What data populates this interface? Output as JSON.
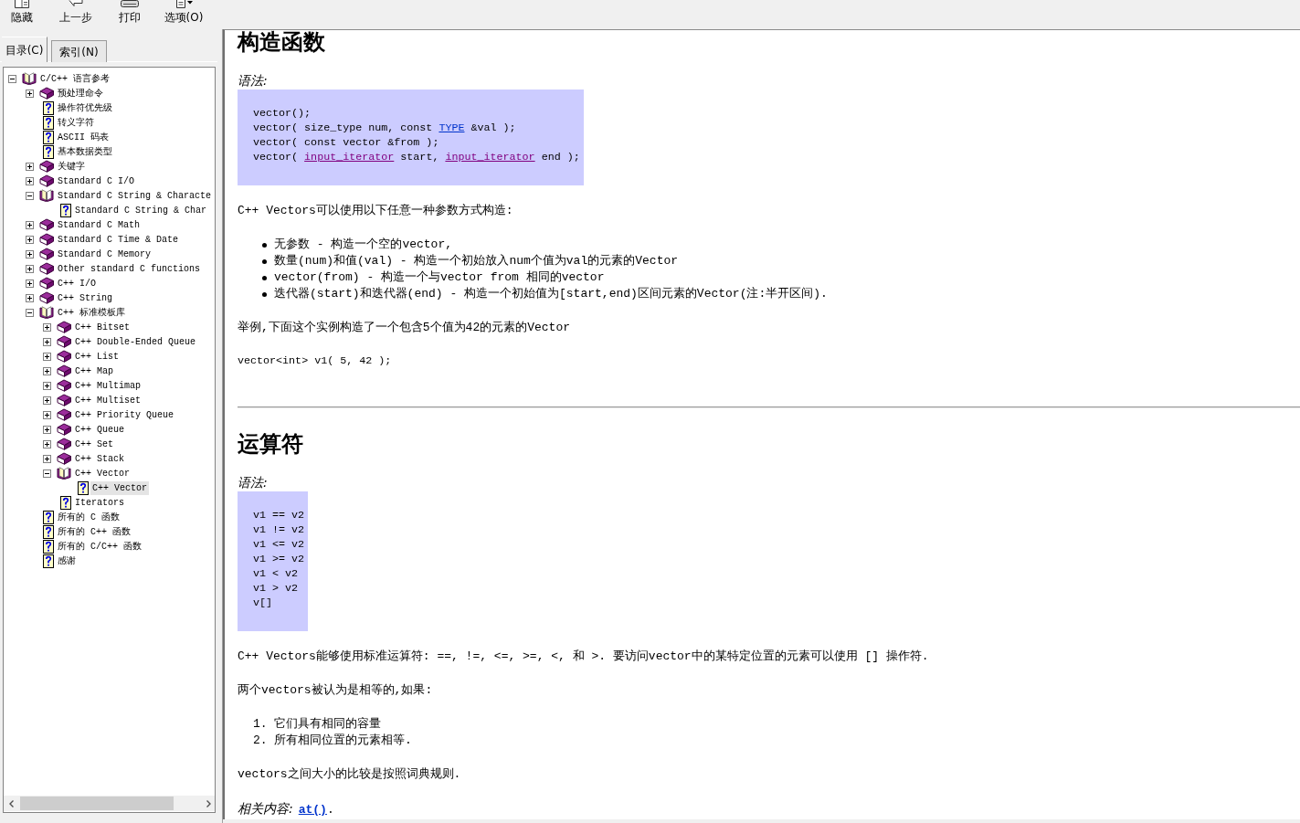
{
  "toolbar": [
    {
      "kind": "hide",
      "label": "隐藏"
    },
    {
      "kind": "back",
      "label": "上一步"
    },
    {
      "kind": "print",
      "label": "打印"
    },
    {
      "kind": "options",
      "label": "选项(O)"
    }
  ],
  "tabs": [
    {
      "label": "目录(C)",
      "selected": true
    },
    {
      "label": "索引(N)",
      "selected": false
    }
  ],
  "tree": [
    {
      "label": "C/C++ 语言参考",
      "kind": "book",
      "expanded": true,
      "selected": false,
      "children": [
        {
          "label": "预处理命令",
          "kind": "book",
          "expanded": false,
          "selected": false
        },
        {
          "label": "操作符优先级",
          "kind": "page",
          "selected": false
        },
        {
          "label": "转义字符",
          "kind": "page",
          "selected": false
        },
        {
          "label": "ASCII 码表",
          "kind": "page",
          "selected": false
        },
        {
          "label": "基本数据类型",
          "kind": "page",
          "selected": false
        },
        {
          "label": "关键字",
          "kind": "book",
          "expanded": false,
          "selected": false
        },
        {
          "label": "Standard C I/O",
          "kind": "book",
          "expanded": false,
          "selected": false
        },
        {
          "label": "Standard C String & Characte",
          "kind": "book",
          "expanded": true,
          "selected": false,
          "children": [
            {
              "label": "Standard C String & Char",
              "kind": "page",
              "selected": false
            }
          ]
        },
        {
          "label": "Standard C Math",
          "kind": "book",
          "expanded": false,
          "selected": false
        },
        {
          "label": "Standard C Time & Date",
          "kind": "book",
          "expanded": false,
          "selected": false
        },
        {
          "label": "Standard C Memory",
          "kind": "book",
          "expanded": false,
          "selected": false
        },
        {
          "label": "Other standard C functions",
          "kind": "book",
          "expanded": false,
          "selected": false
        },
        {
          "label": "C++ I/O",
          "kind": "book",
          "expanded": false,
          "selected": false
        },
        {
          "label": "C++ String",
          "kind": "book",
          "expanded": false,
          "selected": false
        },
        {
          "label": "C++ 标准模板库",
          "kind": "book",
          "expanded": true,
          "selected": false,
          "children": [
            {
              "label": "C++ Bitset",
              "kind": "book",
              "expanded": false,
              "selected": false
            },
            {
              "label": "C++ Double-Ended Queue",
              "kind": "book",
              "expanded": false,
              "selected": false
            },
            {
              "label": "C++ List",
              "kind": "book",
              "expanded": false,
              "selected": false
            },
            {
              "label": "C++ Map",
              "kind": "book",
              "expanded": false,
              "selected": false
            },
            {
              "label": "C++ Multimap",
              "kind": "book",
              "expanded": false,
              "selected": false
            },
            {
              "label": "C++ Multiset",
              "kind": "book",
              "expanded": false,
              "selected": false
            },
            {
              "label": "C++ Priority Queue",
              "kind": "book",
              "expanded": false,
              "selected": false
            },
            {
              "label": "C++ Queue",
              "kind": "book",
              "expanded": false,
              "selected": false
            },
            {
              "label": "C++ Set",
              "kind": "book",
              "expanded": false,
              "selected": false
            },
            {
              "label": "C++ Stack",
              "kind": "book",
              "expanded": false,
              "selected": false
            },
            {
              "label": "C++ Vector",
              "kind": "book",
              "expanded": true,
              "selected": false,
              "children": [
                {
                  "label": "C++ Vector",
                  "kind": "page",
                  "selected": true
                }
              ]
            },
            {
              "label": "Iterators",
              "kind": "page",
              "selected": false
            }
          ]
        },
        {
          "label": "所有的 C 函数",
          "kind": "page",
          "selected": false
        },
        {
          "label": "所有的 C++ 函数",
          "kind": "page",
          "selected": false
        },
        {
          "label": "所有的 C/C++ 函数",
          "kind": "page",
          "selected": false
        },
        {
          "label": "感谢",
          "kind": "page",
          "selected": false
        }
      ]
    }
  ],
  "content": [
    {
      "kind": "heading",
      "text": "构造函数"
    },
    {
      "kind": "label",
      "text": "语法:"
    },
    {
      "kind": "codebox",
      "lines": [
        [
          {
            "kind": "plain",
            "text": "vector();"
          }
        ],
        [
          {
            "kind": "plain",
            "text": "vector( size_type num, const "
          },
          {
            "kind": "link",
            "text": "TYPE",
            "visited": false
          },
          {
            "kind": "plain",
            "text": " &val );"
          }
        ],
        [
          {
            "kind": "plain",
            "text": "vector( const vector &from );"
          }
        ],
        [
          {
            "kind": "plain",
            "text": "vector( "
          },
          {
            "kind": "link",
            "text": "input_iterator",
            "visited": true
          },
          {
            "kind": "plain",
            "text": " start, "
          },
          {
            "kind": "link",
            "text": "input_iterator",
            "visited": true
          },
          {
            "kind": "plain",
            "text": " end );"
          }
        ]
      ]
    },
    {
      "kind": "paragraph",
      "text": "C++ Vectors可以使用以下任意一种参数方式构造:"
    },
    {
      "kind": "bullets",
      "items": [
        "无参数 - 构造一个空的vector,",
        "数量(num)和值(val) - 构造一个初始放入num个值为val的元素的Vector",
        "vector(from) - 构造一个与vector from 相同的vector",
        "迭代器(start)和迭代器(end) - 构造一个初始值为[start,end)区间元素的Vector(注:半开区间)."
      ]
    },
    {
      "kind": "paragraph",
      "text": "举例,下面这个实例构造了一个包含5个值为42的元素的Vector"
    },
    {
      "kind": "code",
      "text": "vector<int> v1( 5, 42 );"
    },
    {
      "kind": "rule"
    },
    {
      "kind": "heading",
      "text": "运算符"
    },
    {
      "kind": "label",
      "text": "语法:"
    },
    {
      "kind": "codebox",
      "lines": [
        [
          {
            "kind": "plain",
            "text": "v1 == v2"
          }
        ],
        [
          {
            "kind": "plain",
            "text": "v1 != v2"
          }
        ],
        [
          {
            "kind": "plain",
            "text": "v1 <= v2"
          }
        ],
        [
          {
            "kind": "plain",
            "text": "v1 >= v2"
          }
        ],
        [
          {
            "kind": "plain",
            "text": "v1 < v2"
          }
        ],
        [
          {
            "kind": "plain",
            "text": "v1 > v2"
          }
        ],
        [
          {
            "kind": "plain",
            "text": "v[]"
          }
        ]
      ]
    },
    {
      "kind": "paragraph",
      "text": "C++ Vectors能够使用标准运算符: ==, !=, <=, >=, <, 和 >. 要访问vector中的某特定位置的元素可以使用 [] 操作符."
    },
    {
      "kind": "paragraph",
      "text": "两个vectors被认为是相等的,如果:"
    },
    {
      "kind": "numbered",
      "items": [
        {
          "number": "1.",
          "text": "它们具有相同的容量"
        },
        {
          "number": "2.",
          "text": "所有相同位置的元素相等."
        }
      ]
    },
    {
      "kind": "paragraph",
      "text": "vectors之间大小的比较是按照词典规则."
    },
    {
      "kind": "related",
      "parts": [
        {
          "kind": "italic",
          "text": "相关内容:"
        },
        {
          "kind": "link",
          "text": "at()",
          "visited": false
        },
        {
          "kind": "plain",
          "text": "."
        }
      ]
    }
  ]
}
